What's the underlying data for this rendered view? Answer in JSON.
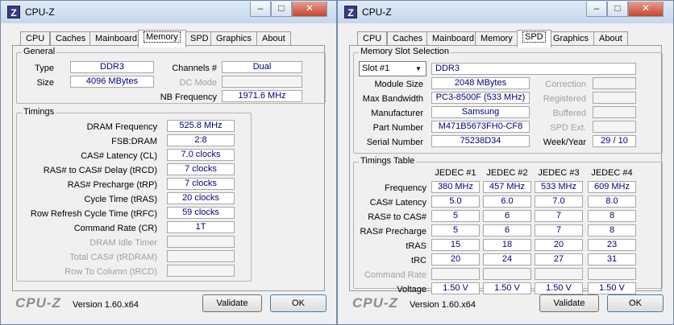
{
  "app": {
    "title": "CPU-Z",
    "brand": "CPU-Z",
    "version": "Version 1.60.x64",
    "validate_label": "Validate",
    "ok_label": "OK",
    "icon_letter": "Z"
  },
  "tabs": [
    "CPU",
    "Caches",
    "Mainboard",
    "Memory",
    "SPD",
    "Graphics",
    "About"
  ],
  "memory": {
    "general_title": "General",
    "type_label": "Type",
    "type_value": "DDR3",
    "size_label": "Size",
    "size_value": "4096 MBytes",
    "channels_label": "Channels #",
    "channels_value": "Dual",
    "dcmode_label": "DC Mode",
    "dcmode_value": "",
    "nbfreq_label": "NB Frequency",
    "nbfreq_value": "1971.6 MHz",
    "timings_title": "Timings",
    "timings": [
      {
        "label": "DRAM Frequency",
        "value": "525.8 MHz",
        "disabled": false
      },
      {
        "label": "FSB:DRAM",
        "value": "2:8",
        "disabled": false
      },
      {
        "label": "CAS# Latency (CL)",
        "value": "7.0 clocks",
        "disabled": false
      },
      {
        "label": "RAS# to CAS# Delay (tRCD)",
        "value": "7 clocks",
        "disabled": false
      },
      {
        "label": "RAS# Precharge (tRP)",
        "value": "7 clocks",
        "disabled": false
      },
      {
        "label": "Cycle Time (tRAS)",
        "value": "20 clocks",
        "disabled": false
      },
      {
        "label": "Row Refresh Cycle Time (tRFC)",
        "value": "59 clocks",
        "disabled": false
      },
      {
        "label": "Command Rate (CR)",
        "value": "1T",
        "disabled": false
      },
      {
        "label": "DRAM Idle Timer",
        "value": "",
        "disabled": true
      },
      {
        "label": "Total CAS# (tRDRAM)",
        "value": "",
        "disabled": true
      },
      {
        "label": "Row To Column (tRCD)",
        "value": "",
        "disabled": true
      }
    ]
  },
  "spd": {
    "slot_title": "Memory Slot Selection",
    "slot_selected": "Slot #1",
    "slot_type": "DDR3",
    "fields": [
      {
        "label": "Module Size",
        "value": "2048 MBytes"
      },
      {
        "label": "Max Bandwidth",
        "value": "PC3-8500F (533 MHz)"
      },
      {
        "label": "Manufacturer",
        "value": "Samsung"
      },
      {
        "label": "Part Number",
        "value": "M471B5673FH0-CF8"
      },
      {
        "label": "Serial Number",
        "value": "75238D34"
      }
    ],
    "right_fields": [
      {
        "label": "Correction",
        "value": "",
        "disabled": true
      },
      {
        "label": "Registered",
        "value": "",
        "disabled": true
      },
      {
        "label": "Buffered",
        "value": "",
        "disabled": true
      },
      {
        "label": "SPD Ext.",
        "value": "",
        "disabled": true
      },
      {
        "label": "Week/Year",
        "value": "29 / 10",
        "disabled": false
      }
    ],
    "timings_title": "Timings Table",
    "columns": [
      "JEDEC #1",
      "JEDEC #2",
      "JEDEC #3",
      "JEDEC #4"
    ],
    "rows": [
      {
        "label": "Frequency",
        "values": [
          "380 MHz",
          "457 MHz",
          "533 MHz",
          "609 MHz"
        ],
        "disabled": false
      },
      {
        "label": "CAS# Latency",
        "values": [
          "5.0",
          "6.0",
          "7.0",
          "8.0"
        ],
        "disabled": false
      },
      {
        "label": "RAS# to CAS#",
        "values": [
          "5",
          "6",
          "7",
          "8"
        ],
        "disabled": false
      },
      {
        "label": "RAS# Precharge",
        "values": [
          "5",
          "6",
          "7",
          "8"
        ],
        "disabled": false
      },
      {
        "label": "tRAS",
        "values": [
          "15",
          "18",
          "20",
          "23"
        ],
        "disabled": false
      },
      {
        "label": "tRC",
        "values": [
          "20",
          "24",
          "27",
          "31"
        ],
        "disabled": false
      },
      {
        "label": "Command Rate",
        "values": [
          "",
          "",
          "",
          ""
        ],
        "disabled": true
      },
      {
        "label": "Voltage",
        "values": [
          "1.50 V",
          "1.50 V",
          "1.50 V",
          "1.50 V"
        ],
        "disabled": false
      }
    ]
  }
}
